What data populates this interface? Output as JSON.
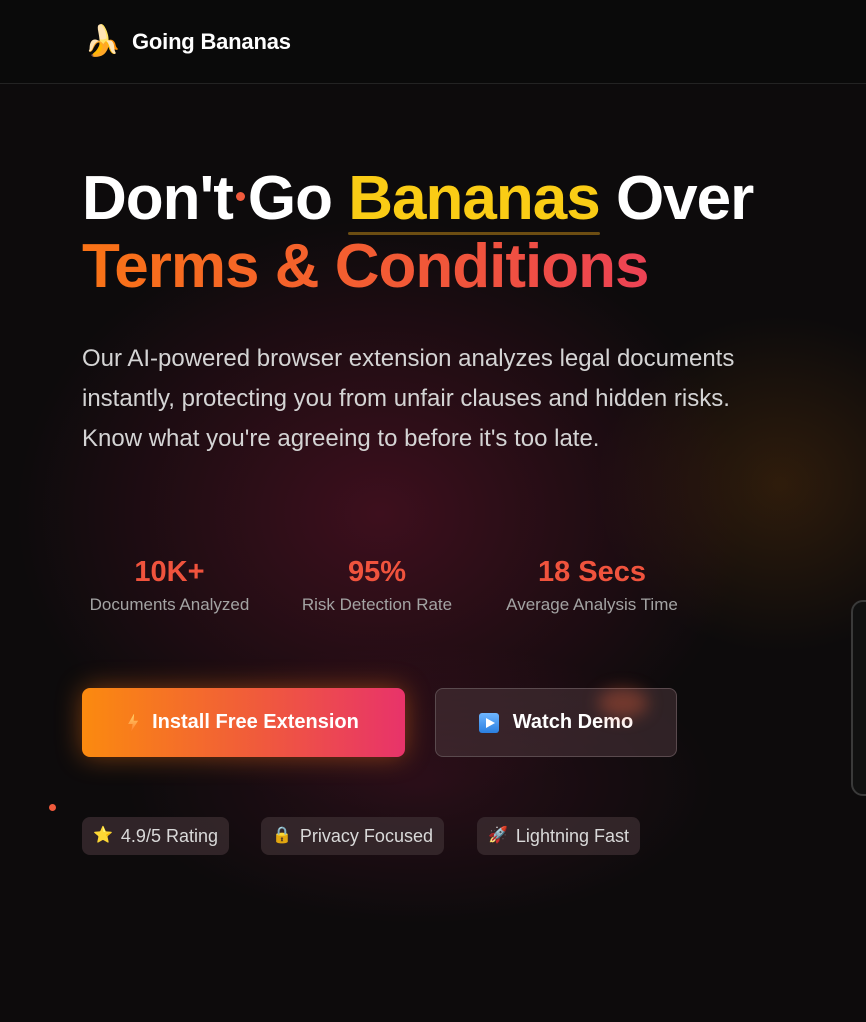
{
  "nav": {
    "logo_icon": "banana-icon",
    "brand": "Going Bananas"
  },
  "hero": {
    "title_word1": "Don't",
    "title_word2": "Go",
    "title_highlight": "Bananas",
    "title_word4": "Over",
    "title_line2": "Terms & Conditions",
    "subtitle": "Our AI-powered browser extension analyzes legal documents instantly, protecting you from unfair clauses and hidden risks. Know what you're agreeing to before it's too late."
  },
  "stats": [
    {
      "value": "10K+",
      "label": "Documents Analyzed"
    },
    {
      "value": "95%",
      "label": "Risk Detection Rate"
    },
    {
      "value": "18 Secs",
      "label": "Average Analysis Time"
    }
  ],
  "buttons": {
    "install_label": "Install Free Extension",
    "install_icon": "lightning-icon",
    "demo_label": "Watch Demo",
    "demo_icon": "play-icon"
  },
  "badges": [
    {
      "icon": "⭐",
      "label": "4.9/5 Rating"
    },
    {
      "icon": "🔒",
      "label": "Privacy Focused"
    },
    {
      "icon": "🚀",
      "label": "Lightning Fast"
    }
  ],
  "colors": {
    "accent_orange": "#f97316",
    "accent_red": "#f0533d",
    "accent_pink": "#e8336a",
    "highlight_yellow": "#facc15",
    "background": "#0b0b0c"
  }
}
